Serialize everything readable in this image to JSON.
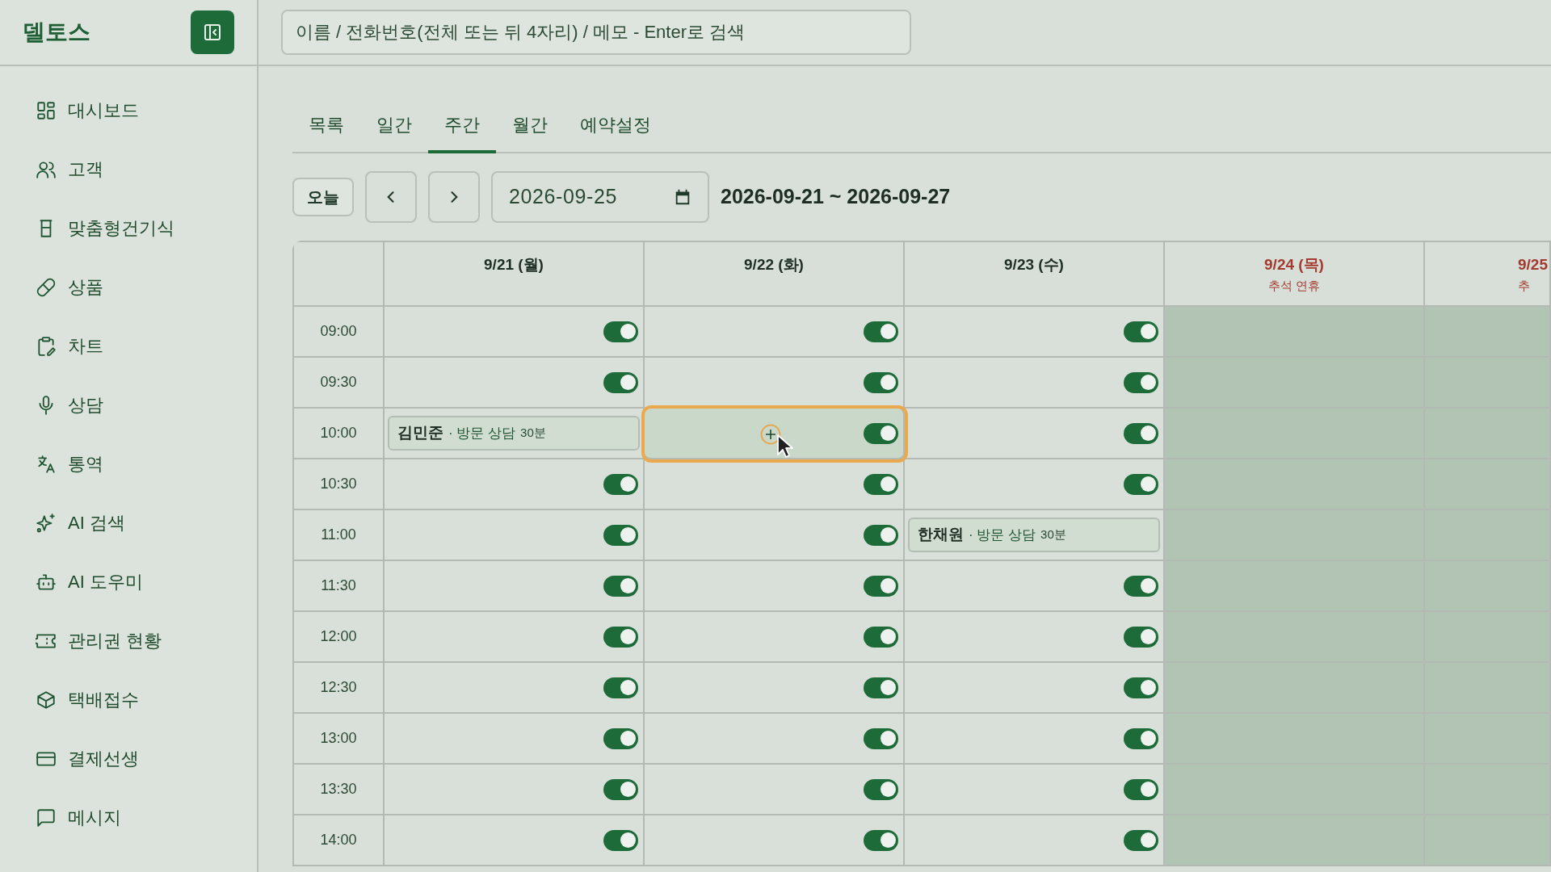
{
  "app": {
    "title": "델토스"
  },
  "search": {
    "placeholder": "이름 / 전화번호(전체 또는 뒤 4자리) / 메모 - Enter로 검색"
  },
  "sidebar": {
    "items": [
      {
        "label": "대시보드"
      },
      {
        "label": "고객"
      },
      {
        "label": "맞춤형건기식"
      },
      {
        "label": "상품"
      },
      {
        "label": "차트"
      },
      {
        "label": "상담"
      },
      {
        "label": "통역"
      },
      {
        "label": "AI 검색"
      },
      {
        "label": "AI 도우미"
      },
      {
        "label": "관리권 현황"
      },
      {
        "label": "택배접수"
      },
      {
        "label": "결제선생"
      },
      {
        "label": "메시지"
      }
    ]
  },
  "tabs": [
    {
      "label": "목록",
      "selected": false
    },
    {
      "label": "일간",
      "selected": false
    },
    {
      "label": "주간",
      "selected": true
    },
    {
      "label": "월간",
      "selected": false
    },
    {
      "label": "예약설정",
      "selected": false
    }
  ],
  "toolbar": {
    "today": "오늘",
    "date": "2026-09-25",
    "range": "2026-09-21 ~ 2026-09-27"
  },
  "days": [
    {
      "label": "9/21 (월)",
      "holiday": false
    },
    {
      "label": "9/22 (화)",
      "holiday": false
    },
    {
      "label": "9/23 (수)",
      "holiday": false
    },
    {
      "label": "9/24 (목)",
      "note": "추석 연휴",
      "holiday": true
    },
    {
      "label": "9/25",
      "note": "추",
      "holiday": true
    }
  ],
  "rows": [
    {
      "time": "09:00",
      "cells": [
        {
          "kind": "slot",
          "on": true
        },
        {
          "kind": "slot",
          "on": true
        },
        {
          "kind": "slot",
          "on": true
        },
        {
          "kind": "closed"
        },
        {
          "kind": "closed"
        }
      ]
    },
    {
      "time": "09:30",
      "cells": [
        {
          "kind": "slot",
          "on": true
        },
        {
          "kind": "slot",
          "on": true
        },
        {
          "kind": "slot",
          "on": true
        },
        {
          "kind": "closed"
        },
        {
          "kind": "closed"
        }
      ]
    },
    {
      "time": "10:00",
      "cells": [
        {
          "kind": "event",
          "name": "김민준",
          "detail": "· 방문 상담",
          "duration": "30분"
        },
        {
          "kind": "slot",
          "on": true,
          "hovered": true
        },
        {
          "kind": "slot",
          "on": true
        },
        {
          "kind": "closed"
        },
        {
          "kind": "closed"
        }
      ]
    },
    {
      "time": "10:30",
      "cells": [
        {
          "kind": "slot",
          "on": true
        },
        {
          "kind": "slot",
          "on": true
        },
        {
          "kind": "slot",
          "on": true
        },
        {
          "kind": "closed"
        },
        {
          "kind": "closed"
        }
      ]
    },
    {
      "time": "11:00",
      "cells": [
        {
          "kind": "slot",
          "on": true
        },
        {
          "kind": "slot",
          "on": true
        },
        {
          "kind": "event",
          "name": "한채원",
          "detail": "· 방문 상담",
          "duration": "30분"
        },
        {
          "kind": "closed"
        },
        {
          "kind": "closed"
        }
      ]
    },
    {
      "time": "11:30",
      "cells": [
        {
          "kind": "slot",
          "on": true
        },
        {
          "kind": "slot",
          "on": true
        },
        {
          "kind": "slot",
          "on": true
        },
        {
          "kind": "closed"
        },
        {
          "kind": "closed"
        }
      ]
    },
    {
      "time": "12:00",
      "cells": [
        {
          "kind": "slot",
          "on": true
        },
        {
          "kind": "slot",
          "on": true
        },
        {
          "kind": "slot",
          "on": true
        },
        {
          "kind": "closed"
        },
        {
          "kind": "closed"
        }
      ]
    },
    {
      "time": "12:30",
      "cells": [
        {
          "kind": "slot",
          "on": true
        },
        {
          "kind": "slot",
          "on": true
        },
        {
          "kind": "slot",
          "on": true
        },
        {
          "kind": "closed"
        },
        {
          "kind": "closed"
        }
      ]
    },
    {
      "time": "13:00",
      "cells": [
        {
          "kind": "slot",
          "on": true
        },
        {
          "kind": "slot",
          "on": true
        },
        {
          "kind": "slot",
          "on": true
        },
        {
          "kind": "closed"
        },
        {
          "kind": "closed"
        }
      ]
    },
    {
      "time": "13:30",
      "cells": [
        {
          "kind": "slot",
          "on": true
        },
        {
          "kind": "slot",
          "on": true
        },
        {
          "kind": "slot",
          "on": true
        },
        {
          "kind": "closed"
        },
        {
          "kind": "closed"
        }
      ]
    },
    {
      "time": "14:00",
      "cells": [
        {
          "kind": "slot",
          "on": true
        },
        {
          "kind": "slot",
          "on": true
        },
        {
          "kind": "slot",
          "on": true
        },
        {
          "kind": "closed"
        },
        {
          "kind": "closed"
        }
      ]
    }
  ]
}
